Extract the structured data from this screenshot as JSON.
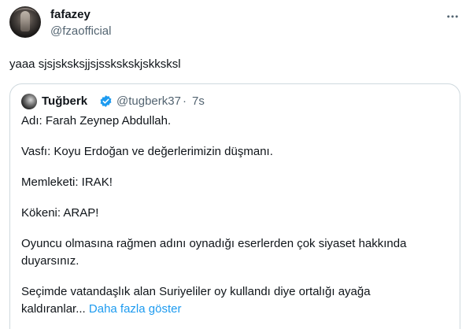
{
  "author": {
    "name": "fafazey",
    "handle": "@fzaofficial",
    "avatar_icon": "profile-photo"
  },
  "tweet": {
    "text": "yaaa sjsjsksksjjsjsskskskjskksksl"
  },
  "quoted": {
    "name": "Tuğberk",
    "verified_icon": "verified-badge-icon",
    "handle": "@tugberk37",
    "separator": "·",
    "time": "7s",
    "lines": [
      "Adı: Farah Zeynep Abdullah.",
      "Vasfı: Koyu Erdoğan ve değerlerimizin düşmanı.",
      "Memleketi: IRAK!",
      "Kökeni: ARAP!",
      "Oyuncu olmasına rağmen adını oynadığı eserlerden çok siyaset hakkında",
      "duyarsınız.",
      "Seçimde vatandaşlık alan Suriyeliler oy kullandı diye ortalığı ayağa",
      "kaldıranlar..."
    ],
    "show_more": "Daha fazla göster"
  },
  "colors": {
    "text": "#0f1419",
    "secondary": "#536471",
    "accent": "#1d9bf0",
    "border": "#cfd9de"
  }
}
